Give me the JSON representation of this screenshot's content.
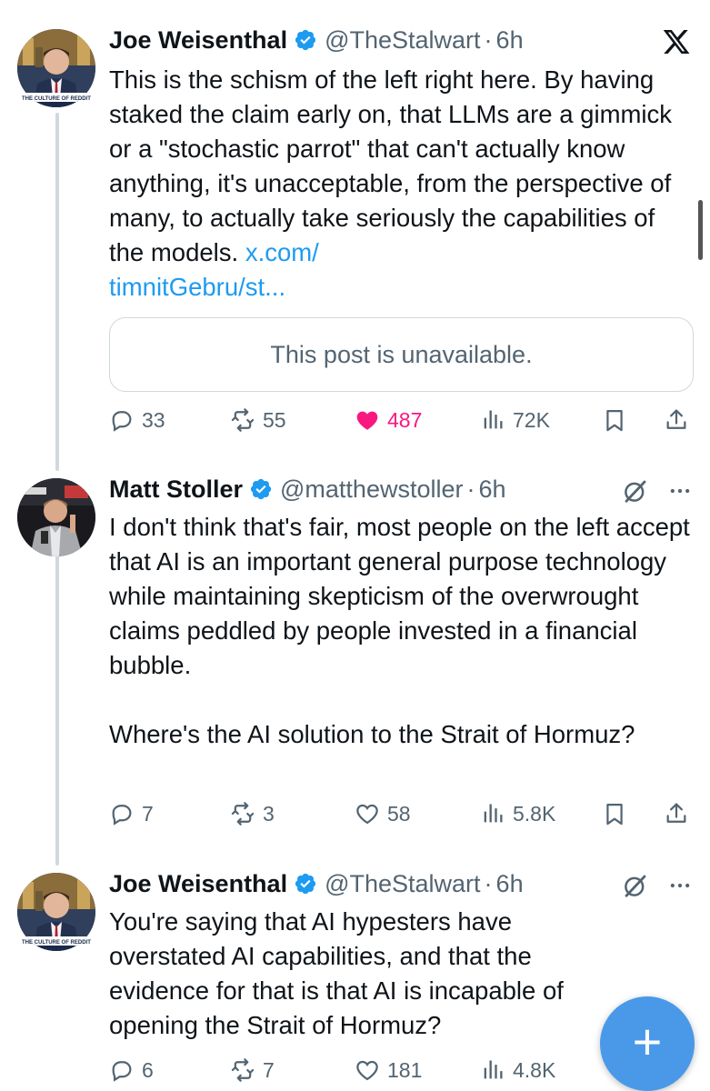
{
  "tweets": [
    {
      "name": "Joe Weisenthal",
      "handle": "@TheStalwart",
      "separator": "·",
      "time": "6h",
      "text": "This is the schism of the left right here. By having staked the claim early on, that LLMs are a gimmick or a \"stochastic parrot\" that can't actually know anything, it's unacceptable, from the perspective of many, to actually take seriously the capabilities of the models. ",
      "link_text": "x.com/\ntimnitGebru/st...",
      "quote_text": "This post is unavailable.",
      "replies": "33",
      "reposts": "55",
      "likes": "487",
      "liked": true,
      "views": "72K",
      "avatar_caption": "THE CULTURE OF REDDIT"
    },
    {
      "name": "Matt Stoller",
      "handle": "@matthewstoller",
      "separator": "·",
      "time": "6h",
      "text": "I don't think that's fair, most people on the left accept that AI is an important general purpose technology while maintaining skepticism of the overwrought claims peddled by people invested in a financial bubble.\n\nWhere's the AI solution to the Strait of Hormuz?",
      "replies": "7",
      "reposts": "3",
      "likes": "58",
      "liked": false,
      "views": "5.8K"
    },
    {
      "name": "Joe Weisenthal",
      "handle": "@TheStalwart",
      "separator": "·",
      "time": "6h",
      "text": "You're saying that AI hypesters have overstated AI capabilities, and that the evidence for that is that AI is incapable of opening the Strait of Hormuz?",
      "replies": "6",
      "reposts": "7",
      "likes": "181",
      "liked": false,
      "views": "4.8K",
      "avatar_caption": "THE CULTURE OF REDDIT"
    }
  ],
  "icons": {
    "x_logo": "x-logo-icon",
    "grok": "grok-icon",
    "more": "more-icon",
    "reply": "reply-icon",
    "repost": "repost-icon",
    "like": "heart-icon",
    "views": "views-icon",
    "bookmark": "bookmark-icon",
    "share": "share-icon",
    "compose": "plus-icon"
  },
  "fab_label": "+",
  "colors": {
    "text": "#0f1419",
    "secondary": "#536471",
    "link": "#1d9bf0",
    "verified": "#1d9bf0",
    "like_active": "#f91880",
    "fab": "#4a99e9",
    "thread_line": "#cfd9de"
  }
}
